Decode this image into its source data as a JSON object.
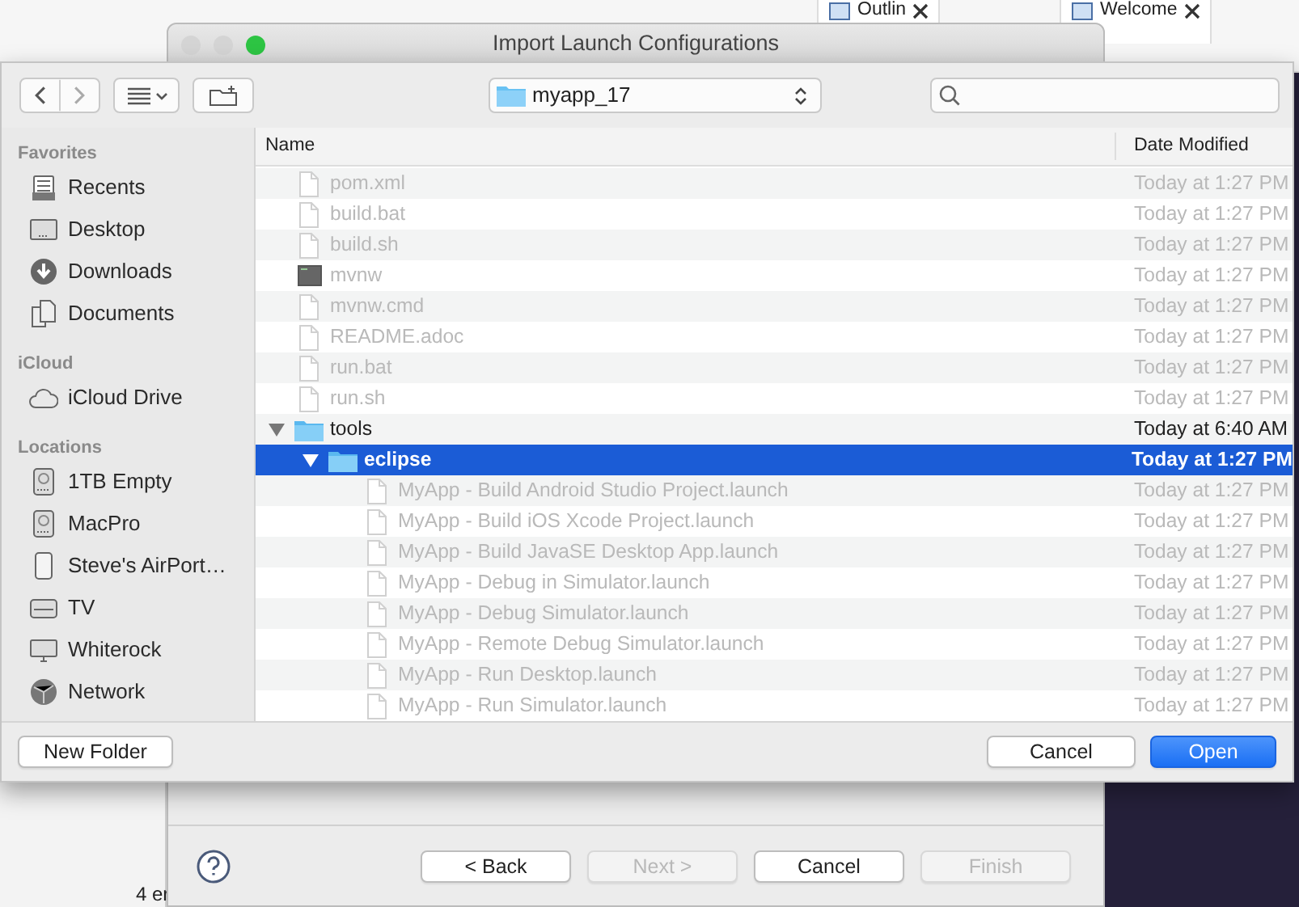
{
  "ide": {
    "tabs": [
      {
        "label": "Outlin"
      },
      {
        "label": "Welcome"
      }
    ],
    "status_text": "4 er"
  },
  "wizard": {
    "title": "Import Launch Configurations",
    "buttons": [
      {
        "label": "< Back",
        "disabled": false
      },
      {
        "label": "Next >",
        "disabled": true
      },
      {
        "label": "Cancel",
        "disabled": false
      },
      {
        "label": "Finish",
        "disabled": true
      }
    ]
  },
  "sheet": {
    "location": "myapp_17",
    "sidebar": [
      {
        "heading": "Favorites",
        "items": [
          {
            "label": "Recents",
            "kind": "recents"
          },
          {
            "label": "Desktop",
            "kind": "desktop"
          },
          {
            "label": "Downloads",
            "kind": "downloads"
          },
          {
            "label": "Documents",
            "kind": "documents"
          }
        ]
      },
      {
        "heading": "iCloud",
        "items": [
          {
            "label": "iCloud Drive",
            "kind": "cloud"
          }
        ]
      },
      {
        "heading": "Locations",
        "items": [
          {
            "label": "1TB Empty",
            "kind": "disk"
          },
          {
            "label": "MacPro",
            "kind": "disk"
          },
          {
            "label": "Steve's AirPort…",
            "kind": "device"
          },
          {
            "label": "TV",
            "kind": "tv"
          },
          {
            "label": "Whiterock",
            "kind": "display"
          },
          {
            "label": "Network",
            "kind": "network"
          }
        ]
      }
    ],
    "columns": [
      "Name",
      "Date Modified"
    ],
    "rows": [
      {
        "name": "pom.xml",
        "date": "Today at 1:27 PM",
        "kind": "file",
        "disabled": true,
        "selected": false
      },
      {
        "name": "build.bat",
        "date": "Today at 1:27 PM",
        "kind": "file",
        "disabled": true,
        "selected": false
      },
      {
        "name": "build.sh",
        "date": "Today at 1:27 PM",
        "kind": "file",
        "disabled": true,
        "selected": false
      },
      {
        "name": "mvnw",
        "date": "Today at 1:27 PM",
        "kind": "exec",
        "disabled": true,
        "selected": false
      },
      {
        "name": "mvnw.cmd",
        "date": "Today at 1:27 PM",
        "kind": "file",
        "disabled": true,
        "selected": false
      },
      {
        "name": "README.adoc",
        "date": "Today at 1:27 PM",
        "kind": "file",
        "disabled": true,
        "selected": false
      },
      {
        "name": "run.bat",
        "date": "Today at 1:27 PM",
        "kind": "file",
        "disabled": true,
        "selected": false
      },
      {
        "name": "run.sh",
        "date": "Today at 1:27 PM",
        "kind": "file",
        "disabled": true,
        "selected": false
      },
      {
        "name": "tools",
        "date": "Today at 6:40 AM",
        "kind": "folder",
        "disabled": false,
        "selected": false,
        "expanded": true,
        "children": [
          {
            "name": "eclipse",
            "date": "Today at 1:27 PM",
            "kind": "folder",
            "disabled": false,
            "selected": true,
            "expanded": true,
            "children": [
              {
                "name": "MyApp - Build Android Studio Project.launch",
                "date": "Today at 1:27 PM",
                "kind": "file",
                "disabled": true,
                "selected": false
              },
              {
                "name": "MyApp - Build iOS Xcode Project.launch",
                "date": "Today at 1:27 PM",
                "kind": "file",
                "disabled": true,
                "selected": false
              },
              {
                "name": "MyApp - Build JavaSE Desktop App.launch",
                "date": "Today at 1:27 PM",
                "kind": "file",
                "disabled": true,
                "selected": false
              },
              {
                "name": "MyApp - Debug in Simulator.launch",
                "date": "Today at 1:27 PM",
                "kind": "file",
                "disabled": true,
                "selected": false
              },
              {
                "name": "MyApp - Debug Simulator.launch",
                "date": "Today at 1:27 PM",
                "kind": "file",
                "disabled": true,
                "selected": false
              },
              {
                "name": "MyApp - Remote Debug Simulator.launch",
                "date": "Today at 1:27 PM",
                "kind": "file",
                "disabled": true,
                "selected": false
              },
              {
                "name": "MyApp - Run Desktop.launch",
                "date": "Today at 1:27 PM",
                "kind": "file",
                "disabled": true,
                "selected": false
              },
              {
                "name": "MyApp - Run Simulator.launch",
                "date": "Today at 1:27 PM",
                "kind": "file",
                "disabled": true,
                "selected": false
              }
            ]
          }
        ]
      }
    ],
    "buttons": [
      {
        "label": "New Folder",
        "kind": "secondary"
      },
      {
        "label": "Cancel",
        "kind": "default"
      },
      {
        "label": "Open",
        "kind": "primary"
      }
    ]
  }
}
